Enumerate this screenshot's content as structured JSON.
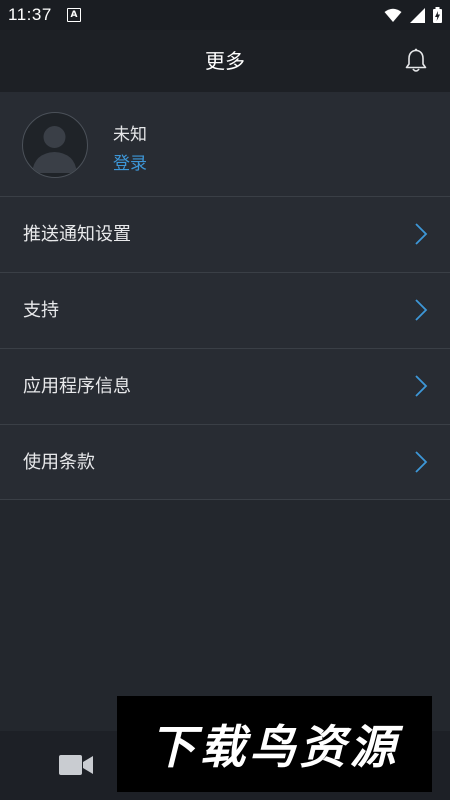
{
  "status_bar": {
    "time": "11:37",
    "notification_glyph": "A"
  },
  "header": {
    "title": "更多"
  },
  "profile": {
    "name": "未知",
    "login_label": "登录"
  },
  "menu": {
    "items": [
      {
        "label": "推送通知设置"
      },
      {
        "label": "支持"
      },
      {
        "label": "应用程序信息"
      },
      {
        "label": "使用条款"
      }
    ]
  },
  "watermark": {
    "text": "下载鸟资源"
  },
  "colors": {
    "accent": "#3d97d8",
    "background": "#23272d",
    "header": "#1d2025",
    "row": "#282c33",
    "divider": "#3a3f46"
  },
  "icons": {
    "status": [
      "notification-a-icon",
      "wifi-icon",
      "signal-icon",
      "battery-icon"
    ],
    "header": "bell-icon",
    "avatar": "user-silhouette-icon",
    "row": "chevron-right-icon",
    "bottom": "video-camera-icon"
  }
}
